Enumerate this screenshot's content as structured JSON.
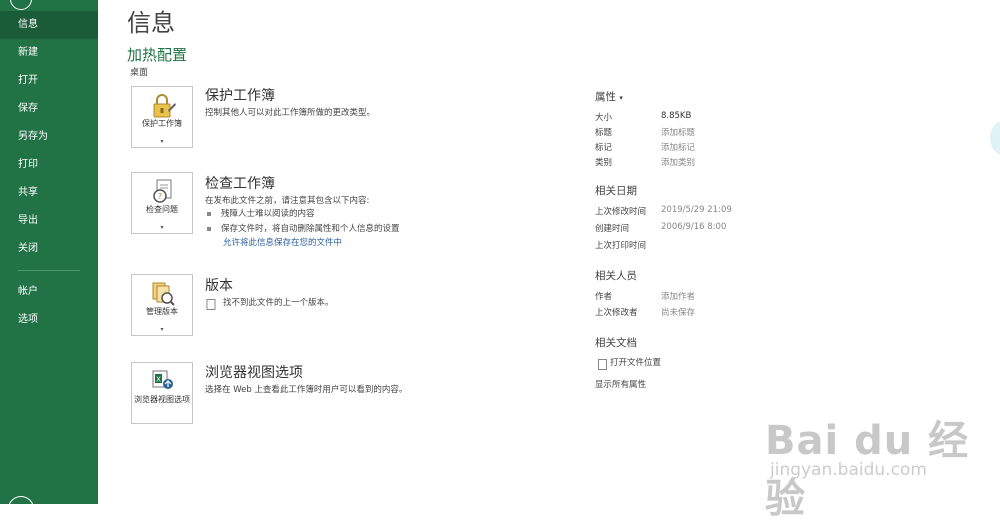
{
  "sidebar": {
    "items": [
      {
        "label": "信息",
        "active": true
      },
      {
        "label": "新建"
      },
      {
        "label": "打开"
      },
      {
        "label": "保存"
      },
      {
        "label": "另存为"
      },
      {
        "label": "打印"
      },
      {
        "label": "共享"
      },
      {
        "label": "导出"
      },
      {
        "label": "关闭"
      },
      {
        "label": "帐户"
      },
      {
        "label": "选项"
      }
    ]
  },
  "main": {
    "title": "信息",
    "file_name": "加热配置",
    "file_path": "桌面",
    "sections": [
      {
        "button_label": "保护工作簿",
        "heading": "保护工作簿",
        "description": "控制其他人可以对此工作簿所做的更改类型。",
        "icon": "lock-icon"
      },
      {
        "button_label": "检查问题",
        "heading": "检查工作簿",
        "description": "在发布此文件之前，请注意其包含以下内容:",
        "bullets": [
          "残障人士难以阅读的内容",
          "保存文件时，将自动删除属性和个人信息的设置"
        ],
        "link": "允许将此信息保存在您的文件中",
        "icon": "inspect-document-icon"
      },
      {
        "button_label": "管理版本",
        "heading": "版本",
        "description": "找不到此文件的上一个版本。",
        "icon": "manage-versions-icon"
      },
      {
        "button_label": "浏览器视图选项",
        "heading": "浏览器视图选项",
        "description": "选择在 Web 上查看此工作簿时用户可以看到的内容。",
        "icon": "browser-view-icon"
      }
    ]
  },
  "properties": {
    "heading": "属性",
    "rows": [
      {
        "key": "大小",
        "value": "8.85KB"
      },
      {
        "key": "标题",
        "value": "添加标题"
      },
      {
        "key": "标记",
        "value": "添加标记"
      },
      {
        "key": "类别",
        "value": "添加类别"
      }
    ],
    "dates_heading": "相关日期",
    "dates": [
      {
        "key": "上次修改时间",
        "value": "2019/5/29 21:09"
      },
      {
        "key": "创建时间",
        "value": "2006/9/16 8:00"
      },
      {
        "key": "上次打印时间",
        "value": ""
      }
    ],
    "people_heading": "相关人员",
    "people": [
      {
        "key": "作者",
        "value": "添加作者"
      },
      {
        "key": "上次修改者",
        "value": "尚未保存"
      }
    ],
    "docs_heading": "相关文档",
    "open_location": "打开文件位置",
    "show_all": "显示所有属性"
  },
  "watermark": {
    "main": "Bai du 经验",
    "sub": "jingyan.baidu.com"
  },
  "colors": {
    "sidebar_bg": "#217346",
    "sidebar_active": "#1a5c38",
    "accent_green": "#217346",
    "link": "#2a5f9e"
  }
}
